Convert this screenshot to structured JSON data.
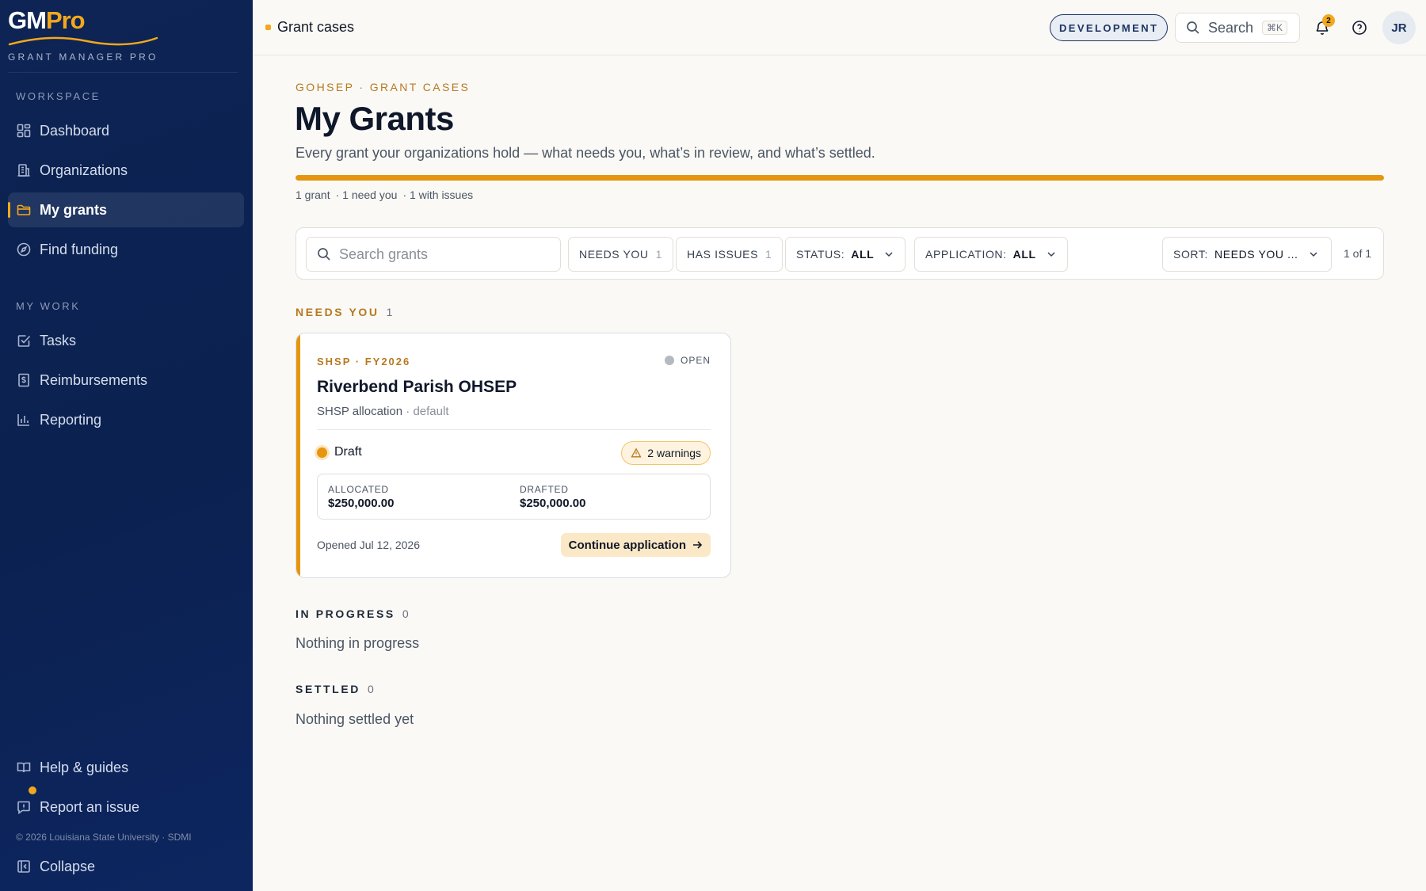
{
  "brand": {
    "logo_gm": "GM",
    "logo_pro": "Pro",
    "subtitle": "GRANT MANAGER PRO"
  },
  "sidebar": {
    "workspace_label": "WORKSPACE",
    "workspace_items": [
      {
        "label": "Dashboard",
        "icon": "dashboard-icon"
      },
      {
        "label": "Organizations",
        "icon": "building-icon"
      },
      {
        "label": "My grants",
        "icon": "folder-icon",
        "active": true
      },
      {
        "label": "Find funding",
        "icon": "compass-icon"
      }
    ],
    "mywork_label": "MY WORK",
    "mywork_items": [
      {
        "label": "Tasks",
        "icon": "checkbox-icon"
      },
      {
        "label": "Reimbursements",
        "icon": "receipt-icon"
      },
      {
        "label": "Reporting",
        "icon": "bar-chart-icon"
      }
    ],
    "help_label": "Help & guides",
    "report_label": "Report an issue",
    "copyright": "© 2026 Louisiana State University · SDMI",
    "collapse_label": "Collapse"
  },
  "topbar": {
    "breadcrumb": "Grant cases",
    "environment": "DEVELOPMENT",
    "search_label": "Search",
    "search_shortcut": "⌘K",
    "notification_count": "2",
    "avatar_initials": "JR"
  },
  "main": {
    "eyebrow": "GOHSEP · GRANT CASES",
    "title": "My Grants",
    "description": "Every grant your organizations hold — what needs you, what’s in review, and what’s settled.",
    "progress_fraction": 1.0,
    "summary": [
      "1 grant",
      "· 1 need you",
      "· 1 with issues"
    ]
  },
  "filters": {
    "search_placeholder": "Search grants",
    "needs_you_label": "NEEDS YOU",
    "needs_you_count": "1",
    "has_issues_label": "HAS ISSUES",
    "has_issues_count": "1",
    "status_label": "STATUS:",
    "status_value": "ALL",
    "application_label": "APPLICATION:",
    "application_value": "ALL",
    "sort_label": "SORT:",
    "sort_value": "NEEDS YOU ...",
    "pager": "1 of 1"
  },
  "sections": {
    "needs_you": {
      "label": "NEEDS YOU",
      "count": "1"
    },
    "in_progress": {
      "label": "IN PROGRESS",
      "count": "0",
      "empty": "Nothing in progress"
    },
    "settled": {
      "label": "SETTLED",
      "count": "0",
      "empty": "Nothing settled yet"
    }
  },
  "card": {
    "program": "SHSP · FY2026",
    "status": "OPEN",
    "title": "Riverbend Parish OHSEP",
    "subtitle": "SHSP allocation",
    "subtitle_muted": "· default",
    "phase": "Draft",
    "warnings": "2 warnings",
    "allocated_label": "ALLOCATED",
    "allocated_value": "$250,000.00",
    "drafted_label": "DRAFTED",
    "drafted_value": "$250,000.00",
    "opened": "Opened Jul 12, 2026",
    "cta": "Continue application"
  },
  "colors": {
    "accent": "#e5960e",
    "sidebar_bg": "#0b2150",
    "brand_gold": "#f2a81d"
  }
}
